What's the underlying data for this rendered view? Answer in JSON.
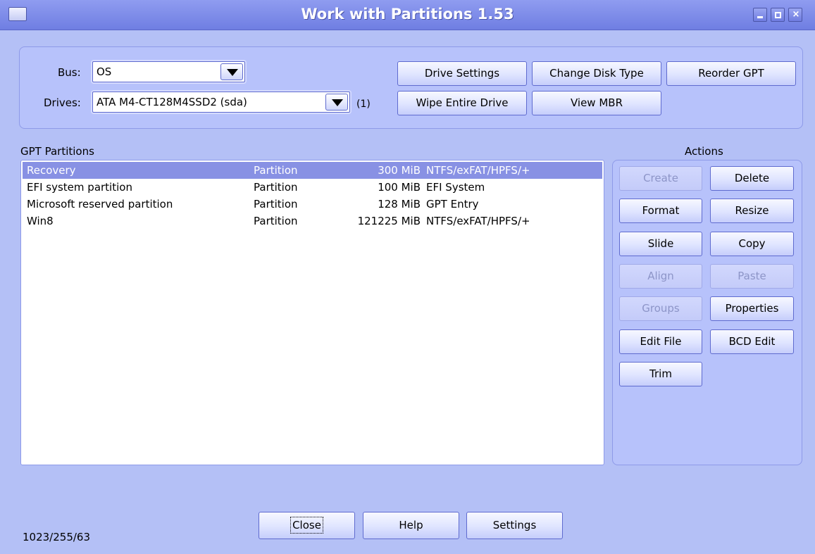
{
  "window": {
    "title": "Work with Partitions 1.53"
  },
  "drive_panel": {
    "bus_label": "Bus:",
    "bus_value": "OS",
    "drives_label": "Drives:",
    "drives_value": "ATA M4-CT128M4SSD2 (sda)",
    "drive_count": "(1)",
    "buttons": {
      "drive_settings": "Drive Settings",
      "change_disk_type": "Change Disk Type",
      "reorder_gpt": "Reorder GPT",
      "wipe_entire_drive": "Wipe Entire Drive",
      "view_mbr": "View MBR"
    }
  },
  "partitions": {
    "header": "GPT Partitions",
    "rows": [
      {
        "name": "Recovery",
        "type": "Partition",
        "size": "300 MiB",
        "fs": "NTFS/exFAT/HPFS/+",
        "selected": true
      },
      {
        "name": "EFI system partition",
        "type": "Partition",
        "size": "100 MiB",
        "fs": "EFI System",
        "selected": false
      },
      {
        "name": "Microsoft reserved partition",
        "type": "Partition",
        "size": "128 MiB",
        "fs": "GPT Entry",
        "selected": false
      },
      {
        "name": "Win8",
        "type": "Partition",
        "size": "121225 MiB",
        "fs": "NTFS/exFAT/HPFS/+",
        "selected": false
      }
    ]
  },
  "actions": {
    "header": "Actions",
    "create": "Create",
    "delete": "Delete",
    "format": "Format",
    "resize": "Resize",
    "slide": "Slide",
    "copy": "Copy",
    "align": "Align",
    "paste": "Paste",
    "groups": "Groups",
    "properties": "Properties",
    "edit_file": "Edit File",
    "bcd_edit": "BCD Edit",
    "trim": "Trim"
  },
  "footer": {
    "geometry": "1023/255/63",
    "close": "Close",
    "help": "Help",
    "settings": "Settings"
  },
  "colors": {
    "titlebar": "#7a88e8",
    "background": "#b4c0f6",
    "selection": "#8891e4"
  }
}
